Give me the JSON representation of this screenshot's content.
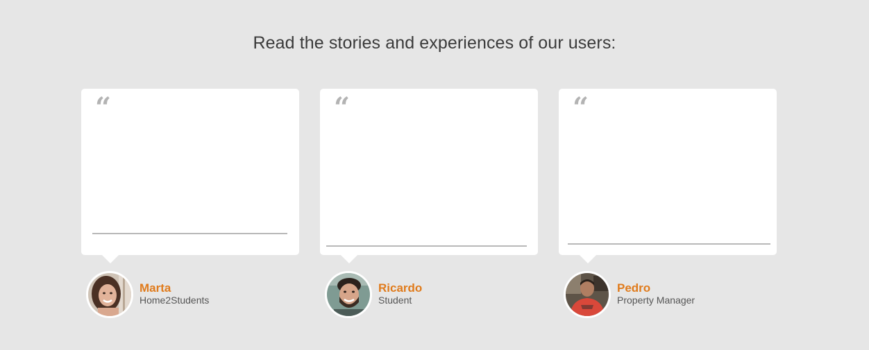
{
  "heading": "Read the stories and experiences of our users:",
  "colors": {
    "background": "#e6e6e6",
    "card": "#ffffff",
    "quote_mark": "#b3b3b3",
    "divider": "#b8b8b8",
    "accent_name": "#e07b1c",
    "role_text": "#555555"
  },
  "testimonials": [
    {
      "quote_mark": "“",
      "name": "Marta",
      "role": "Home2Students",
      "avatar_icon": "avatar-woman-photo"
    },
    {
      "quote_mark": "“",
      "name": "Ricardo",
      "role": "Student",
      "avatar_icon": "avatar-man-photo"
    },
    {
      "quote_mark": "“",
      "name": "Pedro",
      "role": "Property Manager",
      "avatar_icon": "avatar-man-red-shirt-photo"
    }
  ]
}
